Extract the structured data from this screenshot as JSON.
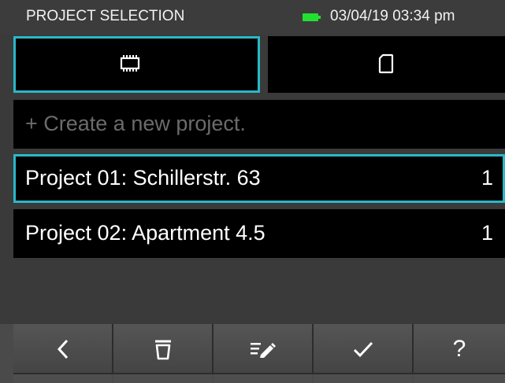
{
  "status_bar": {
    "title": "PROJECT SELECTION",
    "datetime": "03/04/19 03:34 pm",
    "battery_color": "#22e030"
  },
  "storage_tabs": [
    {
      "icon": "memory-chip-icon",
      "selected": true
    },
    {
      "icon": "sd-card-icon",
      "selected": false
    }
  ],
  "list": {
    "create_label": "+ Create a new project.",
    "projects": [
      {
        "name": "Project 01: Schillerstr. 63",
        "count": "1",
        "selected": true
      },
      {
        "name": "Project 02: Apartment 4.5",
        "count": "1",
        "selected": false
      }
    ]
  },
  "toolbar": {
    "buttons": [
      {
        "icon": "back-chevron-icon"
      },
      {
        "icon": "trash-icon"
      },
      {
        "icon": "edit-list-icon"
      },
      {
        "icon": "checkmark-icon"
      },
      {
        "icon": "help-icon",
        "label": "?"
      }
    ]
  },
  "colors": {
    "accent": "#2ab8c8",
    "background": "#3a3a3a",
    "row_background": "#000000",
    "placeholder_text": "#6b6b6b"
  }
}
